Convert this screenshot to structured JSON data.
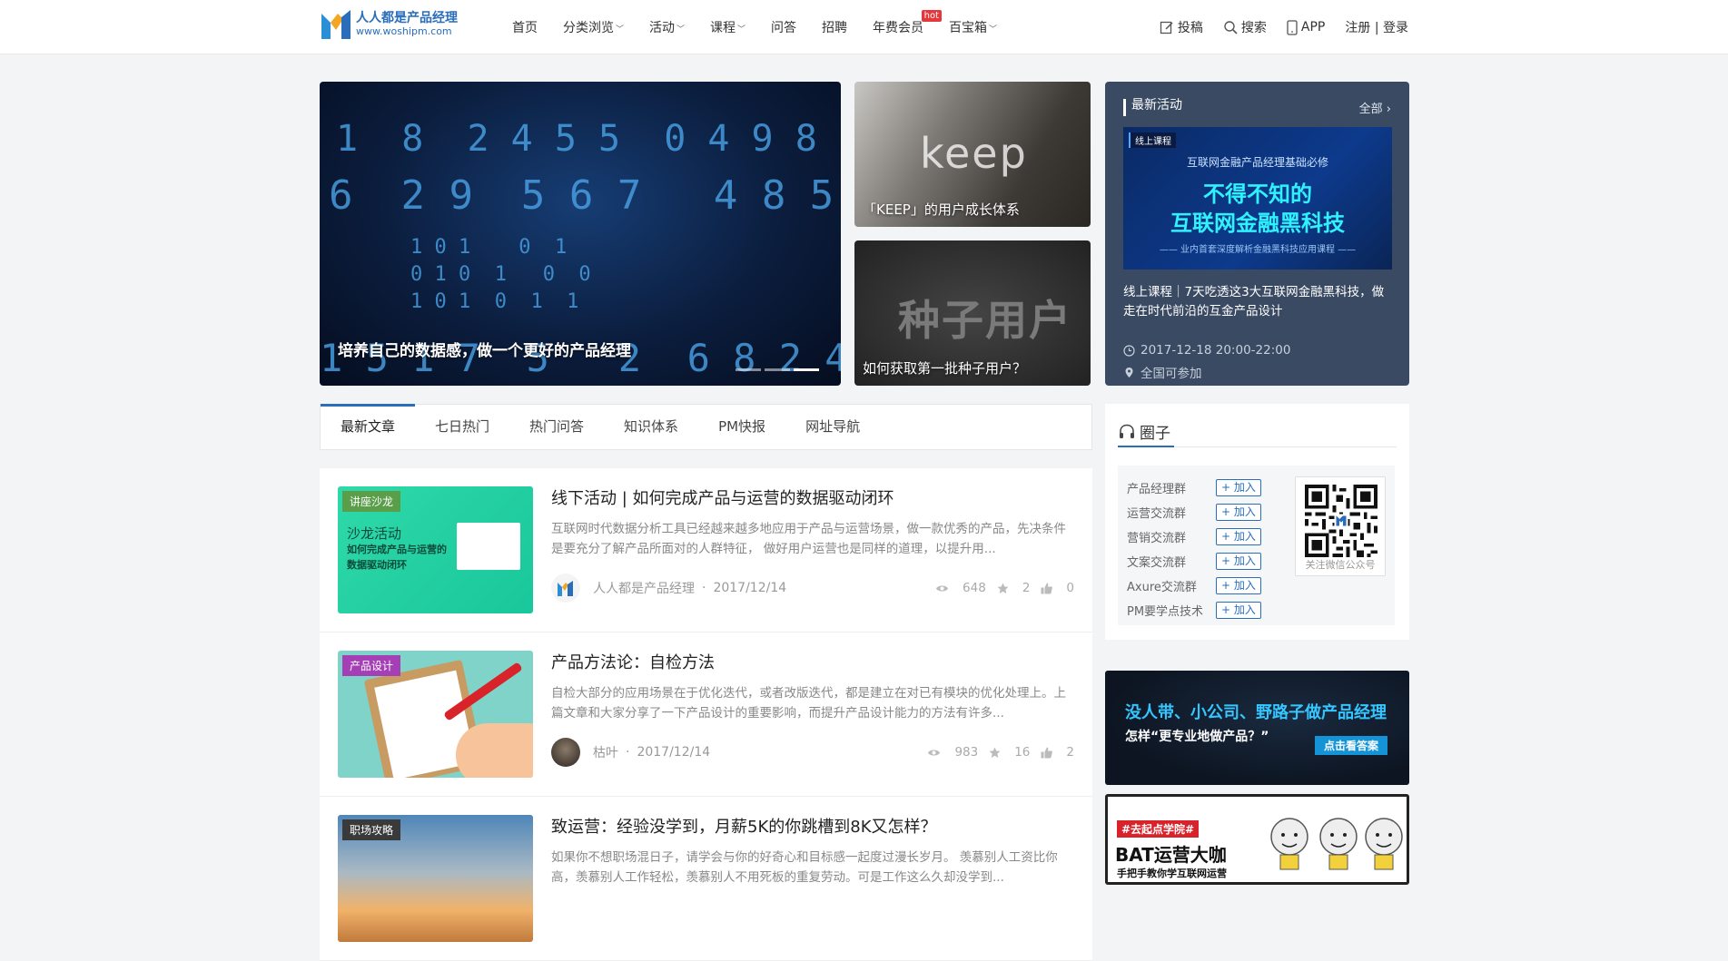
{
  "site": {
    "name_cn": "人人都是产品经理",
    "url": "www.woshipm.com"
  },
  "nav": {
    "items": [
      {
        "label": "首页",
        "caret": false
      },
      {
        "label": "分类浏览",
        "caret": true
      },
      {
        "label": "活动",
        "caret": true
      },
      {
        "label": "课程",
        "caret": true
      },
      {
        "label": "问答",
        "caret": false
      },
      {
        "label": "招聘",
        "caret": false
      },
      {
        "label": "年费会员",
        "caret": false,
        "badge": "hot"
      },
      {
        "label": "百宝箱",
        "caret": true
      }
    ],
    "caret_glyph": "﹀"
  },
  "header_right": {
    "submit": "投稿",
    "search": "搜索",
    "app": "APP",
    "auth": "注册 | 登录"
  },
  "hero": {
    "main_caption": "培养自己的数据感，做一个更好的产品经理",
    "slide_count": 3,
    "active_slide": 3,
    "side": [
      {
        "caption": "「KEEP」的用户成长体系",
        "image_word": "keep"
      },
      {
        "caption": "如何获取第一批种子用户？",
        "image_word": "种子用户"
      }
    ]
  },
  "activity": {
    "title": "最新活动",
    "all_label": "全部",
    "banner": {
      "tag": "线上课程",
      "line1": "互联网金融产品经理基础必修",
      "line2": "不得不知的",
      "line3": "互联网金融黑科技",
      "line4": "—— 业内首套深度解析金融黑科技应用课程 ——"
    },
    "desc": "线上课程｜7天吃透这3大互联网金融黑科技，做走在时代前沿的互金产品设计",
    "time": "2017-12-18 20:00-22:00",
    "location": "全国可参加"
  },
  "tabs": [
    "最新文章",
    "七日热门",
    "热门问答",
    "知识体系",
    "PM快报",
    "网址导航"
  ],
  "active_tab": 0,
  "articles": [
    {
      "tag": "讲座沙龙",
      "tag_color": "#5a9e4a",
      "thumb_lines": [
        "沙龙活动",
        "如何完成产品与运营的",
        "数据驱动闭环"
      ],
      "title": "线下活动 | 如何完成产品与运营的数据驱动闭环",
      "summary": "互联网时代数据分析工具已经越来越多地应用于产品与运营场景，做一款优秀的产品，先决条件是要充分了解产品所面对的人群特征， 做好用户运营也是同样的道理，以提升用...",
      "author": "人人都是产品经理",
      "date": "2017/12/14",
      "views": "648",
      "stars": "2",
      "likes": "0"
    },
    {
      "tag": "产品设计",
      "tag_color": "#a43fb5",
      "thumb_lines": [],
      "title": "产品方法论：自检方法",
      "summary": "自检大部分的应用场景在于优化迭代，或者改版迭代，都是建立在对已有模块的优化处理上。上篇文章和大家分享了一下产品设计的重要影响，而提升产品设计能力的方法有许多...",
      "author": "枯叶",
      "date": "2017/12/14",
      "views": "983",
      "stars": "16",
      "likes": "2"
    },
    {
      "tag": "职场攻略",
      "tag_color": "#3a3a3a",
      "thumb_lines": [],
      "title": "致运营：经验没学到，月薪5K的你跳槽到8K又怎样？",
      "summary": "如果你不想职场混日子，请学会与你的好奇心和目标感一起度过漫长岁月。 羡慕别人工资比你高，羡慕别人工作轻松，羡慕别人不用死板的重复劳动。可是工作这么久却没学到...",
      "author": "",
      "date": "",
      "views": "",
      "stars": "",
      "likes": ""
    }
  ],
  "circle": {
    "title": "圈子",
    "join_label": "+ 加入",
    "groups": [
      "产品经理群",
      "运营交流群",
      "营销交流群",
      "文案交流群",
      "Axure交流群",
      "PM要学点技术"
    ],
    "qr_label": "关注微信公众号"
  },
  "ads": [
    {
      "title": "没人带、小公司、野路子做产品经理",
      "sub": "怎样“更专业地做产品？”",
      "button": "点击看答案"
    },
    {
      "tag": "#去起点学院#",
      "title": "BAT运营大咖",
      "sub": "手把手教你学互联网运营"
    }
  ]
}
